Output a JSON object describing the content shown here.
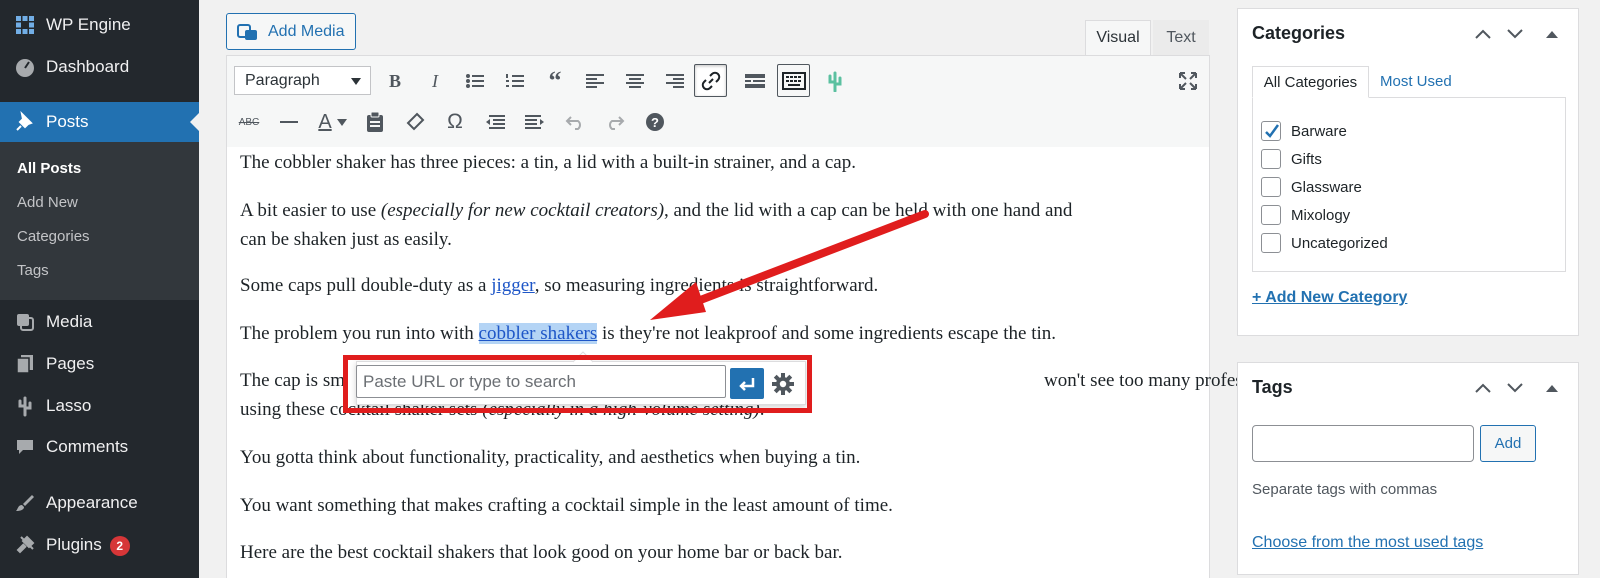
{
  "sidebar": {
    "site_name": "WP Engine",
    "items": [
      {
        "label": "Dashboard",
        "icon": "dashboard-icon"
      },
      {
        "label": "Posts",
        "icon": "pushpin-icon"
      },
      {
        "label": "Media",
        "icon": "media-icon"
      },
      {
        "label": "Pages",
        "icon": "pages-icon"
      },
      {
        "label": "Lasso",
        "icon": "cactus-icon"
      },
      {
        "label": "Comments",
        "icon": "comment-icon"
      },
      {
        "label": "Appearance",
        "icon": "paintbrush-icon"
      },
      {
        "label": "Plugins",
        "icon": "plug-icon",
        "badge": "2"
      }
    ],
    "submenu": [
      "All Posts",
      "Add New",
      "Categories",
      "Tags"
    ]
  },
  "editor": {
    "add_media_label": "Add Media",
    "tabs": [
      "Visual",
      "Text"
    ],
    "format_select": "Paragraph",
    "paragraphs": {
      "p1": "The cobbler shaker has three pieces: a tin, a lid with a built-in strainer, and a cap.",
      "p2a": "A bit easier to use ",
      "p2b": "(especially for new cocktail creators)",
      "p2c": ", and the lid with a cap can be held with one hand and",
      "p2d": "can be shaken just as easily.",
      "p3a": "Some caps pull double-duty as a ",
      "p3b": "jigger",
      "p3c": ", so measuring ingredients is straightforward.",
      "p4a": "The problem you run into with ",
      "p4b": "cobbler shakers",
      "p4c": " is they're not leakproof and some ingredients escape the tin.",
      "p5a": "The cap is sm",
      "p5b": "won't see too many professional bartenders",
      "p5c": "using these cocktail shaker sets ",
      "p5d": "(especially in a high-volume setting)",
      "p5e": ".",
      "p6": "You gotta think about functionality, practicality, and aesthetics when buying a tin.",
      "p7": "You want something that makes crafting a cocktail simple in the least amount of time.",
      "p8": "Here are the best cocktail shakers that look good on your home bar or back bar."
    },
    "link_popup": {
      "placeholder": "Paste URL or type to search"
    }
  },
  "categories_box": {
    "title": "Categories",
    "tabs": [
      "All Categories",
      "Most Used"
    ],
    "items": [
      {
        "label": "Barware",
        "checked": true
      },
      {
        "label": "Gifts",
        "checked": false
      },
      {
        "label": "Glassware",
        "checked": false
      },
      {
        "label": "Mixology",
        "checked": false
      },
      {
        "label": "Uncategorized",
        "checked": false
      }
    ],
    "add_new": "+ Add New Category"
  },
  "tags_box": {
    "title": "Tags",
    "add_button": "Add",
    "hint": "Separate tags with commas",
    "choose_link": "Choose from the most used tags"
  },
  "colors": {
    "accent": "#2271b1",
    "annotation": "#e01d1d",
    "sidebar": "#23282d"
  }
}
